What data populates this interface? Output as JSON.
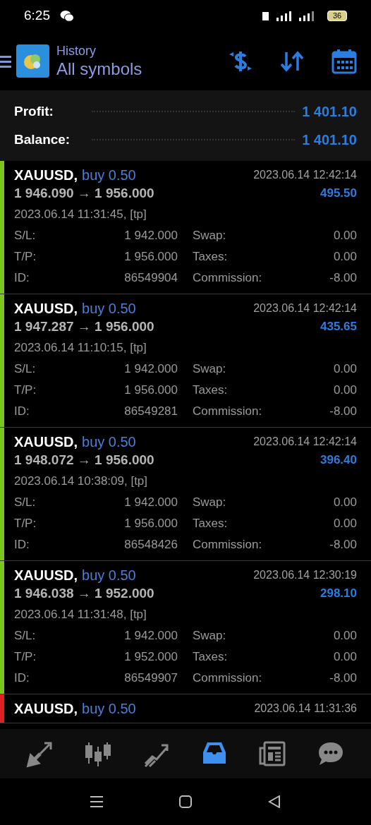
{
  "status_bar": {
    "time": "6:25",
    "battery": "36"
  },
  "header": {
    "title": "History",
    "subtitle": "All symbols"
  },
  "summary": [
    {
      "label": "Profit:",
      "value": "1 401.10"
    },
    {
      "label": "Balance:",
      "value": "1 401.10"
    }
  ],
  "trades": [
    {
      "color": "#7cc520",
      "symbol": "XAUUSD,",
      "side": "buy 0.50",
      "close_time": "2023.06.14 12:42:14",
      "prices": "1 946.090 → 1 956.000",
      "profit": "495.50",
      "open_time": "2023.06.14 11:31:45, [tp]",
      "details": [
        [
          "S/L:",
          "1 942.000",
          "Swap:",
          "0.00"
        ],
        [
          "T/P:",
          "1 956.000",
          "Taxes:",
          "0.00"
        ],
        [
          "ID:",
          "86549904",
          "Commission:",
          "-8.00"
        ]
      ]
    },
    {
      "color": "#7cc520",
      "symbol": "XAUUSD,",
      "side": "buy 0.50",
      "close_time": "2023.06.14 12:42:14",
      "prices": "1 947.287 → 1 956.000",
      "profit": "435.65",
      "open_time": "2023.06.14 11:10:15, [tp]",
      "details": [
        [
          "S/L:",
          "1 942.000",
          "Swap:",
          "0.00"
        ],
        [
          "T/P:",
          "1 956.000",
          "Taxes:",
          "0.00"
        ],
        [
          "ID:",
          "86549281",
          "Commission:",
          "-8.00"
        ]
      ]
    },
    {
      "color": "#7cc520",
      "symbol": "XAUUSD,",
      "side": "buy 0.50",
      "close_time": "2023.06.14 12:42:14",
      "prices": "1 948.072 → 1 956.000",
      "profit": "396.40",
      "open_time": "2023.06.14 10:38:09, [tp]",
      "details": [
        [
          "S/L:",
          "1 942.000",
          "Swap:",
          "0.00"
        ],
        [
          "T/P:",
          "1 956.000",
          "Taxes:",
          "0.00"
        ],
        [
          "ID:",
          "86548426",
          "Commission:",
          "-8.00"
        ]
      ]
    },
    {
      "color": "#7cc520",
      "symbol": "XAUUSD,",
      "side": "buy 0.50",
      "close_time": "2023.06.14 12:30:19",
      "prices": "1 946.038 → 1 952.000",
      "profit": "298.10",
      "open_time": "2023.06.14 11:31:48, [tp]",
      "details": [
        [
          "S/L:",
          "1 942.000",
          "Swap:",
          "0.00"
        ],
        [
          "T/P:",
          "1 952.000",
          "Taxes:",
          "0.00"
        ],
        [
          "ID:",
          "86549907",
          "Commission:",
          "-8.00"
        ]
      ]
    },
    {
      "color": "#e02020",
      "symbol": "XAUUSD,",
      "side": "buy 0.50",
      "close_time": "2023.06.14 11:31:36"
    }
  ],
  "bottom_nav": [
    {
      "kind": "trade",
      "selected": false
    },
    {
      "kind": "quotes",
      "selected": false
    },
    {
      "kind": "chart",
      "selected": false
    },
    {
      "kind": "history",
      "selected": true
    },
    {
      "kind": "news",
      "selected": false
    },
    {
      "kind": "chat",
      "selected": false
    }
  ]
}
